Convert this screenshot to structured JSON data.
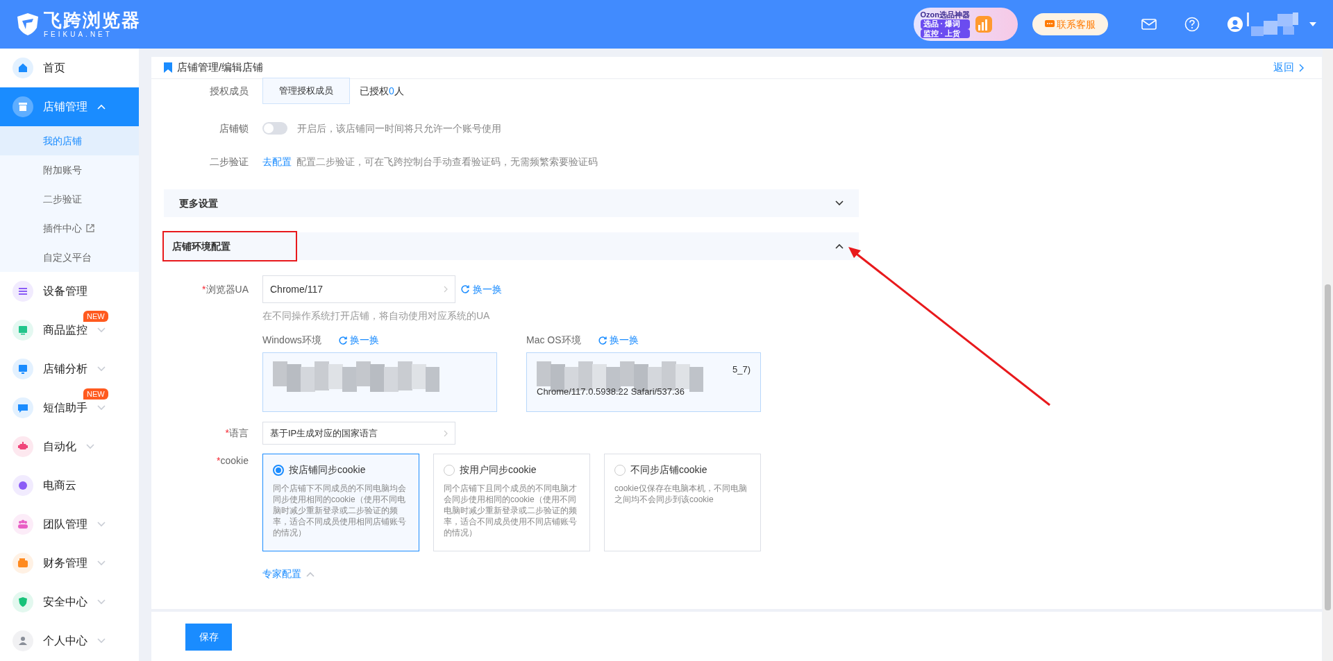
{
  "header": {
    "logo_title": "飞跨浏览器",
    "logo_subtitle": "FEIKUA.NET",
    "promo": {
      "title": "Ozon选品神器",
      "lines": [
        "选品 · 爆词",
        "监控 · 上货"
      ]
    },
    "support_button": "联系客服"
  },
  "sidebar": {
    "items": [
      {
        "label": "首页",
        "kind": "home",
        "color": "#1a8cff",
        "selected": false
      },
      {
        "label": "店铺管理",
        "kind": "store",
        "selected": true,
        "expanded": true,
        "children": [
          {
            "label": "我的店铺",
            "selected": true
          },
          {
            "label": "附加账号",
            "selected": false
          },
          {
            "label": "二步验证",
            "selected": false
          },
          {
            "label": "插件中心",
            "selected": false,
            "external": true
          },
          {
            "label": "自定义平台",
            "selected": false
          }
        ]
      },
      {
        "label": "设备管理",
        "kind": "device",
        "color": "#8b5cf6",
        "selected": false
      },
      {
        "label": "商品监控",
        "kind": "monitor",
        "color": "#22c58b",
        "selected": false,
        "expanded": false,
        "badge": "NEW"
      },
      {
        "label": "店铺分析",
        "kind": "analysis",
        "color": "#1a8cff",
        "selected": false,
        "expanded": false
      },
      {
        "label": "短信助手",
        "kind": "sms",
        "color": "#1a8cff",
        "selected": false,
        "expanded": false,
        "badge": "NEW"
      },
      {
        "label": "自动化",
        "kind": "robot",
        "color": "#f0457a",
        "selected": false,
        "expanded": false
      },
      {
        "label": "电商云",
        "kind": "cloud",
        "color": "#8b5cf6",
        "selected": false
      },
      {
        "label": "团队管理",
        "kind": "team",
        "color": "#e85fc4",
        "selected": false,
        "expanded": false
      },
      {
        "label": "财务管理",
        "kind": "finance",
        "color": "#ff8a1f",
        "selected": false,
        "expanded": false
      },
      {
        "label": "安全中心",
        "kind": "security",
        "color": "#18c27a",
        "selected": false,
        "expanded": false
      },
      {
        "label": "个人中心",
        "kind": "person",
        "color": "#8a8f99",
        "selected": false,
        "expanded": false
      }
    ]
  },
  "page": {
    "breadcrumb": "店铺管理/编辑店铺",
    "back_link": "返回"
  },
  "members": {
    "label": "授权成员",
    "button": "管理授权成员",
    "text_before": "已授权",
    "count": "0",
    "text_after": "人"
  },
  "store_lock": {
    "label": "店铺锁",
    "on": false,
    "hint": "开启后，该店铺同一时间将只允许一个账号使用"
  },
  "two_step": {
    "label": "二步验证",
    "link": "去配置",
    "hint": "配置二步验证，可在飞跨控制台手动查看验证码，无需频繁索要验证码"
  },
  "sections": [
    {
      "title": "更多设置",
      "expanded": false,
      "highlighted": false
    },
    {
      "title": "店铺环境配置",
      "expanded": true,
      "highlighted": true
    }
  ],
  "env": {
    "ua": {
      "label": "浏览器UA",
      "required_mark": "*",
      "value": "Chrome/117",
      "refresh": "换一换",
      "hint": "在不同操作系统打开店铺，将自动使用对应系统的UA"
    },
    "os_env": [
      {
        "label": "Windows环境",
        "refresh": "换一换"
      },
      {
        "label": "Mac OS环境",
        "refresh": "换一换",
        "line_end": "5_7)",
        "last_line": "Chrome/117.0.5938.22 Safari/537.36"
      }
    ],
    "language": {
      "label": "语言",
      "required_mark": "*",
      "value": "基于IP生成对应的国家语言"
    },
    "cookie": {
      "label": "cookie",
      "required_mark": "*",
      "options": [
        {
          "title": "按店铺同步cookie",
          "description": "同个店铺下不同成员的不同电脑均会同步使用相同的cookie（使用不同电脑时减少重新登录或二步验证的频率，适合不同成员使用相同店铺账号的情况）",
          "selected": true
        },
        {
          "title": "按用户同步cookie",
          "description": "同个店铺下且同个成员的不同电脑才会同步使用相同的cookie（使用不同电脑时减少重新登录或二步验证的频率，适合不同成员使用不同店铺账号的情况）",
          "selected": false
        },
        {
          "title": "不同步店铺cookie",
          "description": "cookie仅保存在电脑本机，不同电脑之间均不会同步到该cookie",
          "selected": false
        }
      ]
    },
    "expert": {
      "label": "专家配置",
      "expanded": true
    }
  },
  "footer": {
    "save_button": "保存"
  }
}
